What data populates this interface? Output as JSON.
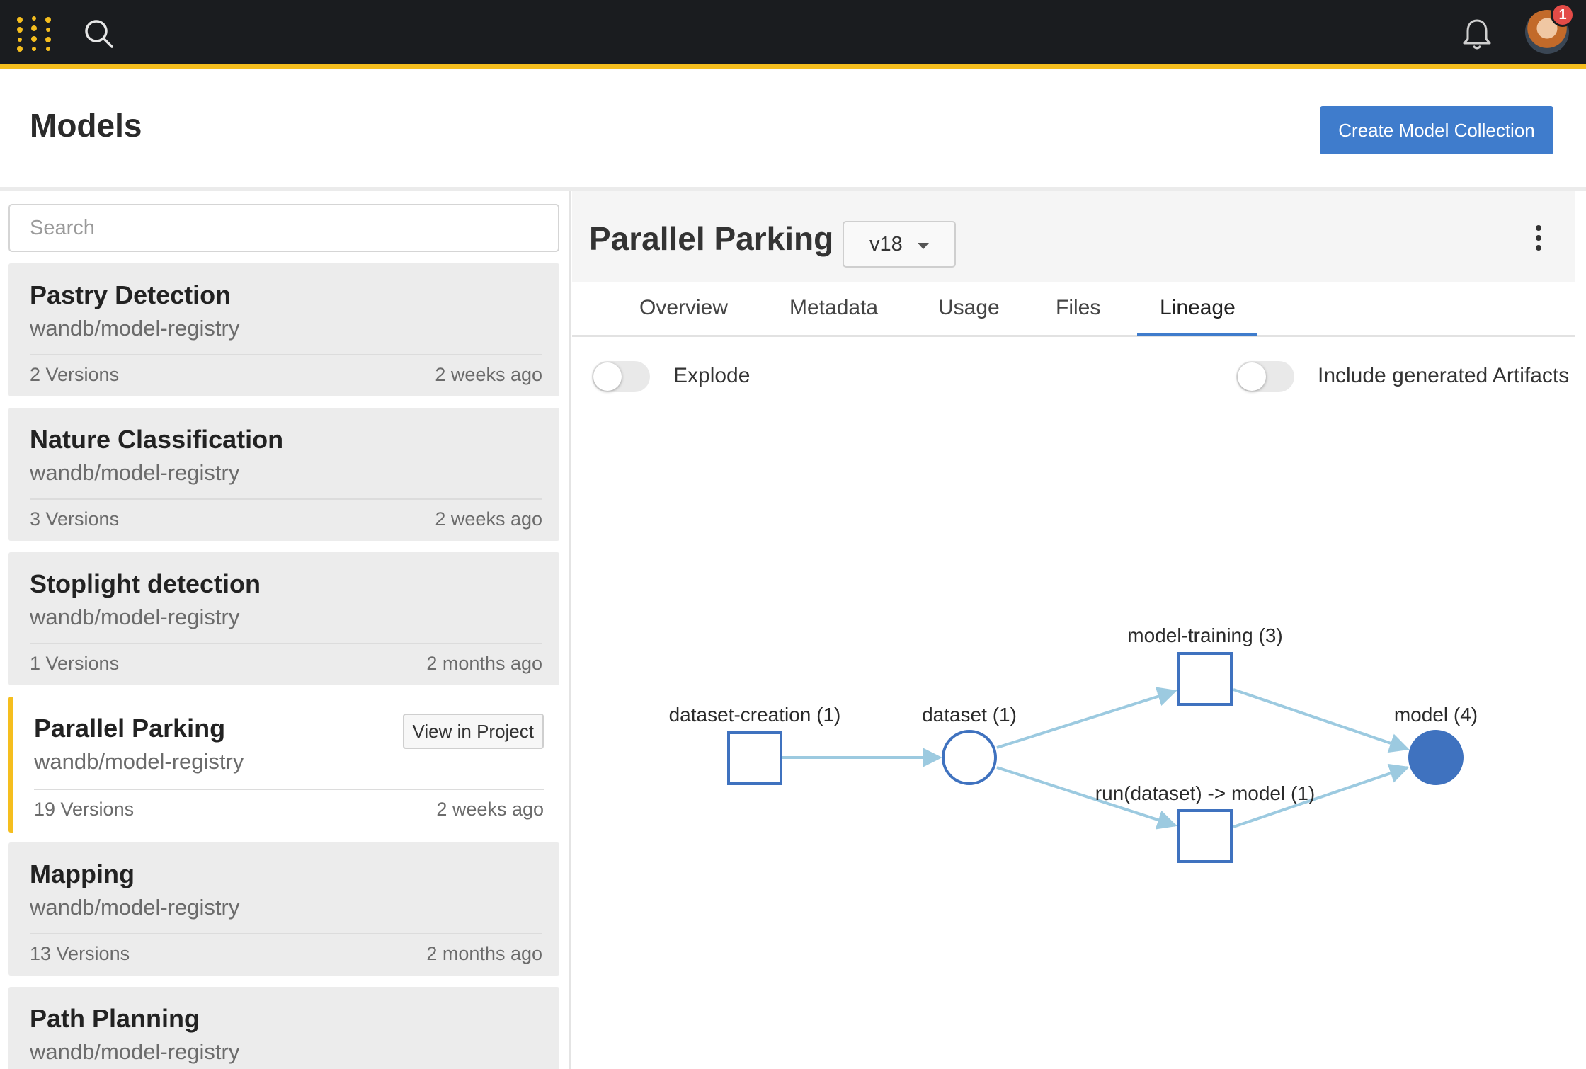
{
  "topbar": {
    "notifications_count": "1",
    "accent_color": "#f5be1e",
    "icons": [
      "app-menu-icon",
      "search-icon",
      "bell-icon"
    ]
  },
  "header": {
    "title": "Models",
    "create_button": "Create Model Collection"
  },
  "sidebar": {
    "search_placeholder": "Search",
    "models": [
      {
        "name": "Pastry Detection",
        "path": "wandb/model-registry",
        "versions": "2 Versions",
        "updated": "2 weeks ago"
      },
      {
        "name": "Nature Classification",
        "path": "wandb/model-registry",
        "versions": "3 Versions",
        "updated": "2 weeks ago"
      },
      {
        "name": "Stoplight detection",
        "path": "wandb/model-registry",
        "versions": "1 Versions",
        "updated": "2 months ago"
      },
      {
        "name": "Parallel Parking",
        "path": "wandb/model-registry",
        "versions": "19 Versions",
        "updated": "2 weeks ago",
        "action": "View in Project"
      },
      {
        "name": "Mapping",
        "path": "wandb/model-registry",
        "versions": "13 Versions",
        "updated": "2 months ago"
      },
      {
        "name": "Path Planning",
        "path": "wandb/model-registry"
      }
    ]
  },
  "detail": {
    "title": "Parallel Parking",
    "version": "v18",
    "tabs": [
      "Overview",
      "Metadata",
      "Usage",
      "Files",
      "Lineage"
    ],
    "active_tab": "Lineage",
    "toggles": {
      "explode": "Explode",
      "include_generated": "Include generated Artifacts"
    }
  },
  "lineage": {
    "nodes": {
      "dataset_creation": "dataset-creation (1)",
      "dataset": "dataset (1)",
      "model_training": "model-training (3)",
      "run_dataset_model": "run(dataset) -> model (1)",
      "model": "model (4)"
    },
    "colors": {
      "node": "#3f72bf",
      "edge": "#9ccae0"
    }
  }
}
